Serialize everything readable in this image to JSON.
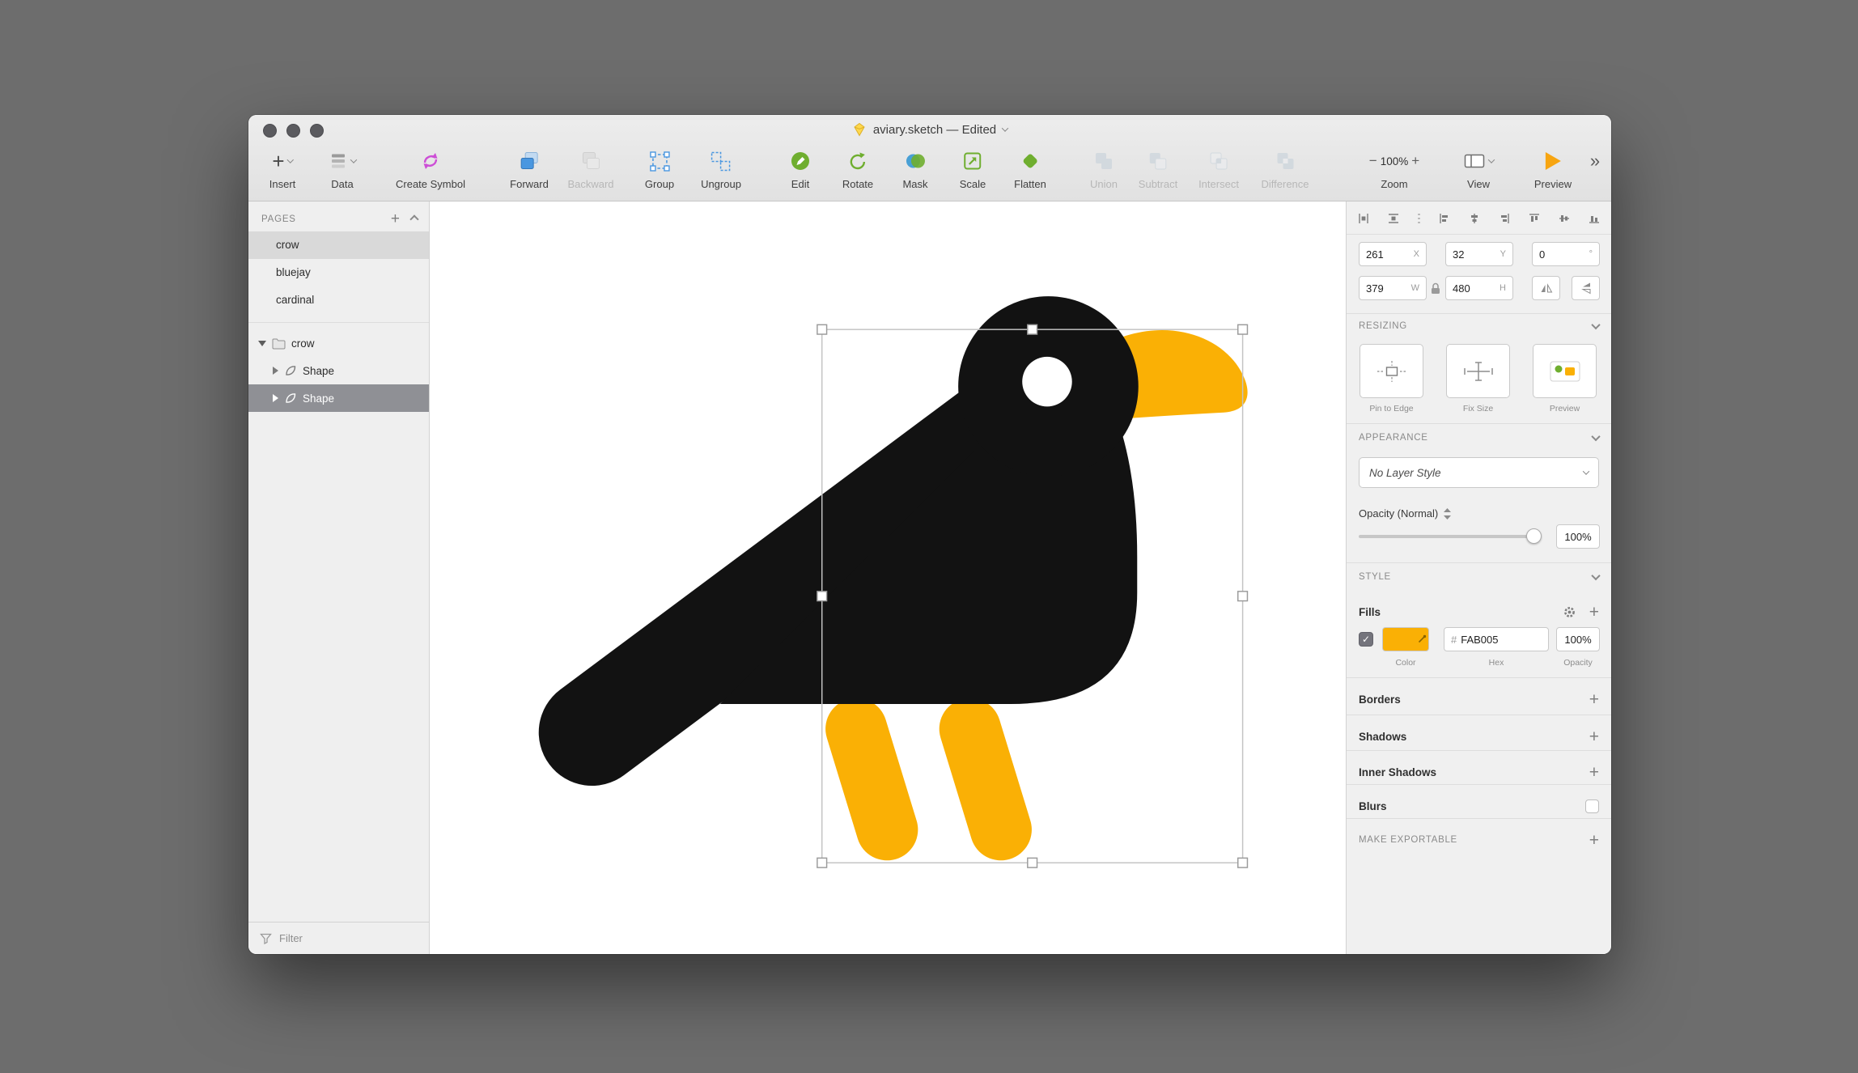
{
  "window": {
    "title": "aviary.sketch — Edited"
  },
  "icons": {
    "check": "✓"
  },
  "toolbar": {
    "insert": "Insert",
    "data": "Data",
    "create_symbol": "Create Symbol",
    "forward": "Forward",
    "backward": "Backward",
    "group": "Group",
    "ungroup": "Ungroup",
    "edit": "Edit",
    "rotate": "Rotate",
    "mask": "Mask",
    "scale": "Scale",
    "flatten": "Flatten",
    "union": "Union",
    "subtract": "Subtract",
    "intersect": "Intersect",
    "difference": "Difference",
    "zoom_label": "Zoom",
    "zoom_value": "100%",
    "zoom_out": "−",
    "zoom_in": "+",
    "view": "View",
    "preview": "Preview",
    "overflow": "»"
  },
  "sidebar": {
    "pages_header": "PAGES",
    "add_page": "+",
    "pages": [
      {
        "name": "crow"
      },
      {
        "name": "bluejay"
      },
      {
        "name": "cardinal"
      }
    ],
    "layers": {
      "artboard": "crow",
      "shape_a": "Shape",
      "shape_b": "Shape"
    },
    "filter": "Filter"
  },
  "inspector": {
    "position": {
      "x": "261",
      "x_unit": "X",
      "y": "32",
      "y_unit": "Y",
      "rotation": "0",
      "rotation_unit": "°"
    },
    "size": {
      "width": "379",
      "width_unit": "W",
      "height": "480",
      "height_unit": "H"
    },
    "resizing_header": "RESIZING",
    "resizing": {
      "pin": "Pin to Edge",
      "fix": "Fix Size",
      "preview": "Preview"
    },
    "appearance_header": "APPEARANCE",
    "appearance": {
      "layer_style": "No Layer Style",
      "opacity_label": "Opacity (Normal)",
      "opacity_value": "100%"
    },
    "style_header": "STYLE",
    "fills": {
      "label": "Fills",
      "hex_prefix": "#",
      "hex": "FAB005",
      "opacity": "100%",
      "color_caption": "Color",
      "hex_caption": "Hex",
      "opacity_caption": "Opacity",
      "add": "+"
    },
    "borders": {
      "label": "Borders",
      "add": "+"
    },
    "shadows": {
      "label": "Shadows",
      "add": "+"
    },
    "inner_shadows": {
      "label": "Inner Shadows",
      "add": "+"
    },
    "blurs": {
      "label": "Blurs"
    },
    "make_exportable": {
      "label": "MAKE EXPORTABLE",
      "add": "+"
    }
  },
  "colors": {
    "accent_orange": "#FAB005",
    "bird_black": "#121212",
    "selected_layer_bg": "#8f9095",
    "toolbar_green": "#6fae2f",
    "toolbar_blue": "#4a97e0",
    "toolbar_magenta": "#cd4fd6",
    "preview_orange": "#f7a511"
  }
}
